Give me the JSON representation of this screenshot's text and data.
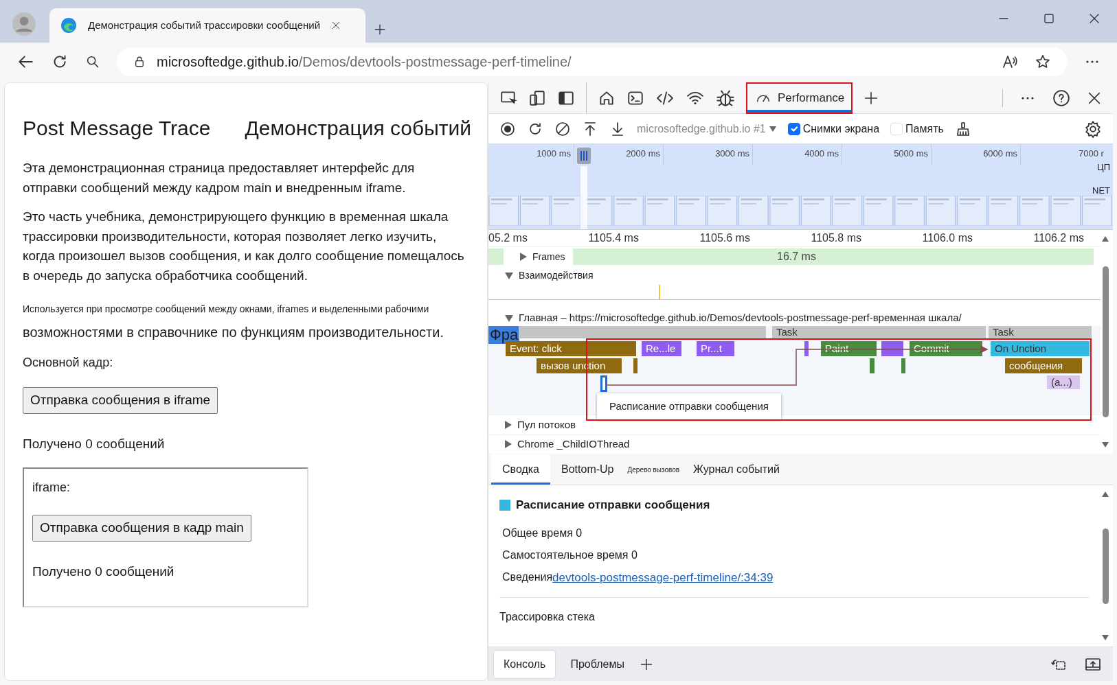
{
  "browser": {
    "tab_title": "Демонстрация событий трассировки сообщений",
    "address": {
      "host": "microsoftedge.github.io",
      "path": "/Demos/devtools-postmessage-perf-timeline/"
    }
  },
  "page": {
    "headings": [
      "Post Message Trace",
      "Демонстрация событий"
    ],
    "paragraphs": [
      "Эта демонстрационная страница предоставляет интерфейс для отправки сообщений между кадром main и внедренным iframe.",
      "Это часть учебника, демонстрирующего функцию в временная шкала трассировки производительности, которая позволяет легко изучить, когда произошел вызов сообщения, и как долго сообщение помещалось в очередь до запуска обработчика сообщений."
    ],
    "note": "Используется при просмотре сообщений между окнами, iframes и выделенными рабочими",
    "note_continuation": "возможностями в справочнике по функциям производительности.",
    "main_frame_label": "Основной кадр:",
    "main_button": "Отправка сообщения в iframe",
    "main_received": "Получено 0 сообщений",
    "iframe": {
      "label": "iframe:",
      "button": "Отправка сообщения в кадр main",
      "received": "Получено 0 сообщений"
    }
  },
  "devtools": {
    "tabs": [
      {
        "label": "Performance",
        "selected": true
      }
    ],
    "target": "microsoftedge.github.io #1",
    "options": [
      {
        "label": "Снимки экрана",
        "checked": true
      },
      {
        "label": "Память",
        "checked": false
      }
    ],
    "overview": {
      "ticks": [
        "1000 ms",
        "2000 ms",
        "3000 ms",
        "4000 ms",
        "5000 ms",
        "6000 ms",
        "7000 r"
      ],
      "lanes": [
        "ЦП",
        "NET"
      ]
    },
    "ruler": [
      "05.2 ms",
      "1105.4 ms",
      "1105.6 ms",
      "1105.8 ms",
      "1106.0 ms",
      "1106.2 ms"
    ],
    "tracks": [
      {
        "kind": "frames",
        "label": "Frames",
        "expanded": false,
        "value": "16.7 ms"
      },
      {
        "kind": "interactions",
        "label": "Взаимодействия",
        "expanded": true
      },
      {
        "kind": "main",
        "label": "Главная – https://microsoftedge.github.io/Demos/devtools-postmessage-perf-временная шкала/",
        "expanded": true
      },
      {
        "kind": "thread",
        "label": "Пул потоков",
        "expanded": false
      },
      {
        "kind": "thread",
        "label": "Chrome _ChildIOThread",
        "expanded": false
      }
    ],
    "frame_label": "Фра",
    "events": [
      {
        "color": "#c4c4c4",
        "selected": false
      },
      {
        "label": "Task",
        "color": "#c4c4c4",
        "selected": false
      },
      {
        "label": "Task",
        "color": "#c4c4c4",
        "selected": false
      },
      {
        "label": "Event: click",
        "color": "#8f6a10",
        "selected": false
      },
      {
        "label": "Re...le",
        "color": "#8f5cf0",
        "selected": false
      },
      {
        "label": "Pr...t",
        "color": "#8f5cf0",
        "selected": false
      },
      {
        "color": "#8f5cf0",
        "selected": false
      },
      {
        "label": "Paint",
        "color": "#4a8c3f",
        "selected": false
      },
      {
        "color": "#8f5cf0",
        "selected": false
      },
      {
        "label": "Commit",
        "color": "#4a8c3f",
        "selected": false
      },
      {
        "label": "On Unction",
        "color": "#33b8e0",
        "selected": false
      },
      {
        "label": "вызов unction",
        "color": "#8f6a10",
        "selected": false
      },
      {
        "color": "#8f6a10",
        "selected": false
      },
      {
        "color": "#4a8c3f",
        "selected": false
      },
      {
        "color": "#4a8c3f",
        "selected": false
      },
      {
        "label": "сообщения",
        "color": "#8f6a10",
        "selected": false
      },
      {
        "color": "#1a6ed8",
        "selected": true
      },
      {
        "label": "(a...)",
        "color": "#d8c6ef",
        "selected": false
      }
    ],
    "tooltip": "Расписание отправки сообщения",
    "bottom_tabs": [
      {
        "label": "Сводка",
        "selected": true,
        "kind": "normal"
      },
      {
        "label": "Bottom-Up",
        "selected": false,
        "kind": "normal"
      },
      {
        "label": "Дерево вызовов",
        "selected": false,
        "kind": "small"
      },
      {
        "label": "Журнал событий",
        "selected": false,
        "kind": "normal"
      }
    ],
    "summary": {
      "title": "Расписание отправки сообщения",
      "rows": [
        "Общее время 0",
        "Самостоятельное время 0"
      ],
      "details_label": "Сведения",
      "details_link": "devtools-postmessage-perf-timeline/:34:39",
      "stack_heading": "Трассировка стека"
    },
    "drawer_tabs": [
      {
        "label": "Консоль",
        "selected": true
      },
      {
        "label": "Проблемы",
        "selected": false
      }
    ]
  }
}
